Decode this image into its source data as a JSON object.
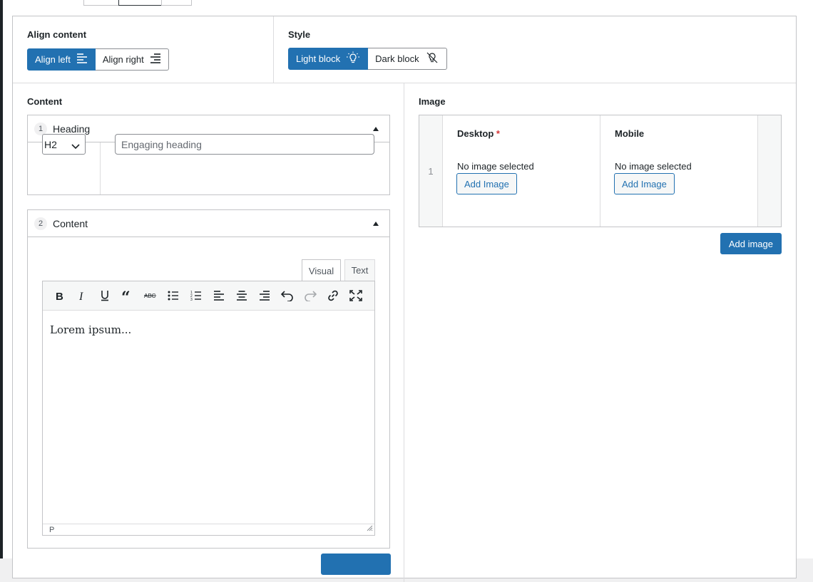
{
  "align": {
    "label": "Align content",
    "options": [
      {
        "label": "Align left",
        "active": true
      },
      {
        "label": "Align right",
        "active": false
      }
    ]
  },
  "style": {
    "label": "Style",
    "options": [
      {
        "label": "Light block",
        "active": true
      },
      {
        "label": "Dark block",
        "active": false
      }
    ]
  },
  "content": {
    "label": "Content",
    "heading": {
      "index": "1",
      "title": "Heading",
      "level": "H2",
      "placeholder": "Engaging heading"
    },
    "body": {
      "index": "2",
      "title": "Content",
      "tabs": [
        "Visual",
        "Text"
      ],
      "active_tab": "Visual",
      "toolbar": [
        "bold-icon",
        "italic-icon",
        "underline-icon",
        "blockquote-icon",
        "strikethrough-icon",
        "bullet-list-icon",
        "numbered-list-icon",
        "align-left-icon",
        "align-center-icon",
        "align-right-icon",
        "undo-icon",
        "redo-icon",
        "link-icon",
        "fullscreen-icon"
      ],
      "text": "Lorem ipsum...",
      "status_path": "P"
    }
  },
  "image": {
    "label": "Image",
    "row_index": "1",
    "desktop": {
      "label": "Desktop",
      "required_mark": "*",
      "status": "No image selected",
      "button": "Add Image"
    },
    "mobile": {
      "label": "Mobile",
      "status": "No image selected",
      "button": "Add Image"
    },
    "add_row_button": "Add image"
  },
  "colors": {
    "accent": "#2271b1",
    "required": "#d63638"
  }
}
